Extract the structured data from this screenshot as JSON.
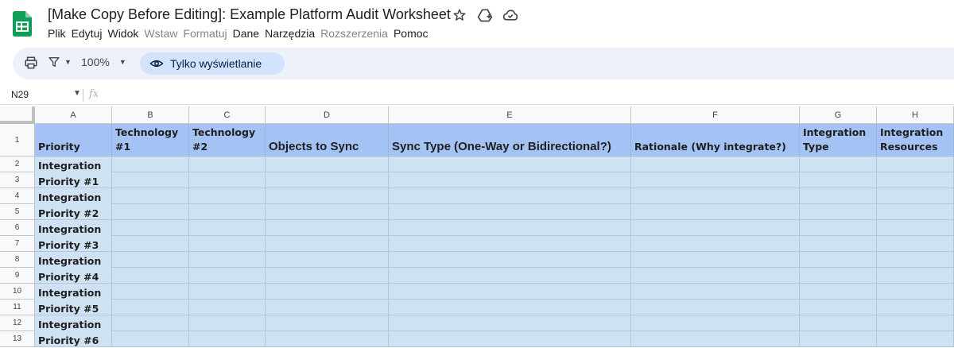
{
  "app": {
    "title": "[Make Copy Before Editing]: Example Platform Audit Worksheet",
    "icons": [
      "star-icon",
      "add-to-drive-icon",
      "cloud-saved-icon"
    ]
  },
  "menu": [
    {
      "label": "Plik",
      "enabled": true
    },
    {
      "label": "Edytuj",
      "enabled": true
    },
    {
      "label": "Widok",
      "enabled": true
    },
    {
      "label": "Wstaw",
      "enabled": false
    },
    {
      "label": "Formatuj",
      "enabled": false
    },
    {
      "label": "Dane",
      "enabled": true
    },
    {
      "label": "Narzędzia",
      "enabled": true
    },
    {
      "label": "Rozszerzenia",
      "enabled": false
    },
    {
      "label": "Pomoc",
      "enabled": true
    }
  ],
  "toolbar": {
    "zoom": "100%",
    "view_mode": "Tylko wyświetlanie"
  },
  "formula_bar": {
    "name_box": "N29",
    "fx": "fx",
    "value": ""
  },
  "columns": [
    "A",
    "B",
    "C",
    "D",
    "E",
    "F",
    "G",
    "H"
  ],
  "row_numbers": [
    "1",
    "2",
    "3",
    "4",
    "5",
    "6",
    "7",
    "8",
    "9",
    "10",
    "11",
    "12",
    "13"
  ],
  "header_row": [
    "Priority",
    "Technology #1",
    "Technology #2",
    "Objects to Sync",
    "Sync Type (One-Way or Bidirectional?)",
    "Rationale (Why integrate?)",
    "Integration Type",
    "Integration Resources"
  ],
  "priorities": [
    {
      "line1": "Integration",
      "line2": "Priority #1"
    },
    {
      "line1": "Integration",
      "line2": "Priority #2"
    },
    {
      "line1": "Integration",
      "line2": "Priority #3"
    },
    {
      "line1": "Integration",
      "line2": "Priority #4"
    },
    {
      "line1": "Integration",
      "line2": "Priority #5"
    },
    {
      "line1": "Integration",
      "line2": "Priority #6"
    }
  ],
  "colors": {
    "header_fill": "#a4c2f4",
    "body_fill": "#cfe2f3",
    "toolbar_bg": "#edf2fa",
    "chip_bg": "#d3e3fd",
    "sheets_green": "#0f9d58"
  }
}
